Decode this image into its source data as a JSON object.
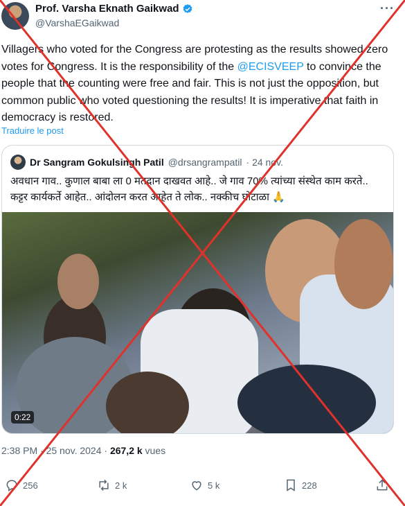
{
  "author": {
    "name": "Prof. Varsha Eknath Gaikwad",
    "handle": "@VarshaEGaikwad"
  },
  "menu": {
    "more_label": "···"
  },
  "tweet": {
    "text_before": "Villagers who voted for the Congress are protesting as the results showed zero votes for Congress. It is the responsibility of the ",
    "mention": "@ECISVEEP",
    "text_after": " to convince the people that the counting were free and fair. This is not just the opposition, but common public who voted questioning the results! It is imperative that faith in democracy is restored.",
    "translate_label": "Traduire le post"
  },
  "quoted": {
    "name": "Dr Sangram Gokulsingh Patil",
    "handle": "@drsangrampatil",
    "date": "· 24 nov.",
    "text": "अवधान गाव.. कुणाल बाबा ला 0 मतदान दाखवत आहे.. जे गाव 70% त्यांच्या संस्थेत काम करते.. कट्टर कार्यकर्ते आहेत.. आंदोलन करत आहेत ते लोक.. नक्कीच घोटाळा 🙏",
    "video_duration": "0:22"
  },
  "timestamp": {
    "time_date": "2:38 PM · 25 nov. 2024 · ",
    "views": "267,2 k",
    "views_label": " vues"
  },
  "actions": {
    "replies": "256",
    "reposts": "2 k",
    "likes": "5 k",
    "bookmarks": "228"
  },
  "colors": {
    "accent": "#1d9bf0",
    "cross": "#e0322b",
    "secondary_text": "#536471"
  }
}
